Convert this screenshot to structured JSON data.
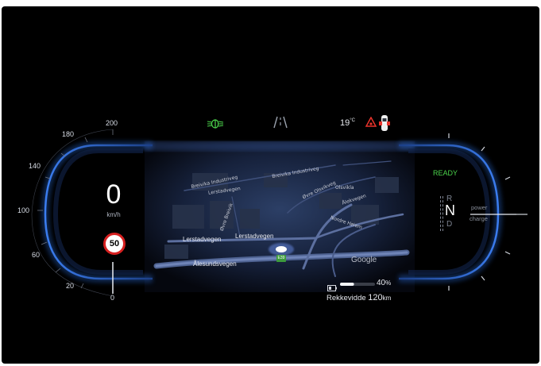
{
  "speedometer": {
    "ticks": [
      "200",
      "180",
      "140",
      "100",
      "60",
      "20",
      "0"
    ],
    "speed_value": "0",
    "speed_unit": "km/h",
    "speed_limit": "50"
  },
  "top_indicators": {
    "headlight_icon": "low-beam-headlight-icon",
    "lane_icon": "lane-assist-icon",
    "outside_temp": "19",
    "temp_unit": "°C",
    "warning_icon": "warning-triangle-icon",
    "car_icon": "car-door-open-icon"
  },
  "drive_panel": {
    "status": "READY",
    "gears": [
      "R",
      "N",
      "D"
    ],
    "active_gear": "N",
    "power_label": "power",
    "charge_label": "charge"
  },
  "map": {
    "streets": {
      "lerstadvegen_1": "Lerstadvegen",
      "lerstadvegen_2": "Lerstadvegen",
      "alesundsvegen": "Ålesundsvegen",
      "nordre_hoiem": "Nordre Høiem",
      "alekvegen": "Ålekvegen"
    },
    "small_labels": {
      "l1": "Breivika Industriveg",
      "l2": "Breivika Industriveg",
      "l3": "Øvre Olsvikveg",
      "l4": "Olsvikla",
      "l5": "Øvre Breivik",
      "l6": "Lerstadvegen"
    },
    "route_shield": "E39",
    "attribution": "Google"
  },
  "battery": {
    "percent": "40",
    "percent_unit": "%",
    "level_fraction": 0.4,
    "range_label": "Rekkevidde",
    "range_value": "120",
    "range_unit": "km"
  },
  "colors": {
    "accent_blue": "#2a6fe0",
    "ready_green": "#4bd34b",
    "warning_red": "#e8332b",
    "speed_limit_red": "#d62020"
  }
}
